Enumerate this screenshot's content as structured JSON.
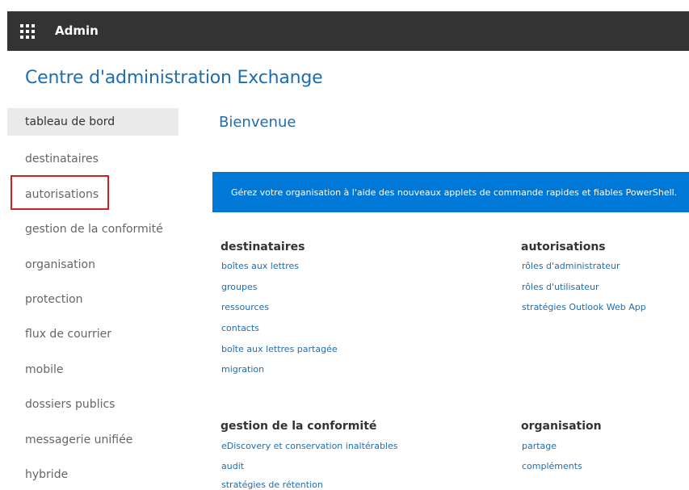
{
  "topbar": {
    "app_name": "Admin",
    "launcher_icon": "app-launcher-waffle-icon"
  },
  "page": {
    "title": "Centre d'administration Exchange",
    "welcome": "Bienvenue"
  },
  "sidebar": {
    "items": [
      {
        "label": "tableau de bord",
        "active": true
      },
      {
        "label": "destinataires"
      },
      {
        "label": "autorisations"
      },
      {
        "label": "gestion de la conformité"
      },
      {
        "label": "organisation"
      },
      {
        "label": "protection"
      },
      {
        "label": "flux de courrier"
      },
      {
        "label": "mobile"
      },
      {
        "label": "dossiers publics"
      },
      {
        "label": "messagerie unifiée"
      },
      {
        "label": "hybride"
      }
    ]
  },
  "banner": {
    "text": "Gérez votre organisation à l'aide des nouveaux applets de commande rapides et fiables PowerShell."
  },
  "sections": {
    "destinataires": {
      "title": "destinataires",
      "links": [
        "boîtes aux lettres",
        "groupes",
        "ressources",
        "contacts",
        "boîte aux lettres partagée",
        "migration"
      ]
    },
    "autorisations": {
      "title": "autorisations",
      "links": [
        "rôles d'administrateur",
        "rôles d'utilisateur",
        "stratégies Outlook Web App"
      ]
    },
    "conformite": {
      "title": "gestion de la conformité",
      "links": [
        "eDiscovery et conservation inaltérables",
        "audit",
        "stratégies de rétention"
      ]
    },
    "organisation": {
      "title": "organisation",
      "links": [
        "partage",
        "compléments"
      ]
    }
  },
  "colors": {
    "topbar": "#333333",
    "accent_blue": "#1f6dae",
    "banner_blue": "#0078d7",
    "highlight_red": "#d42020",
    "active_nav_bg": "#eaeaea"
  }
}
